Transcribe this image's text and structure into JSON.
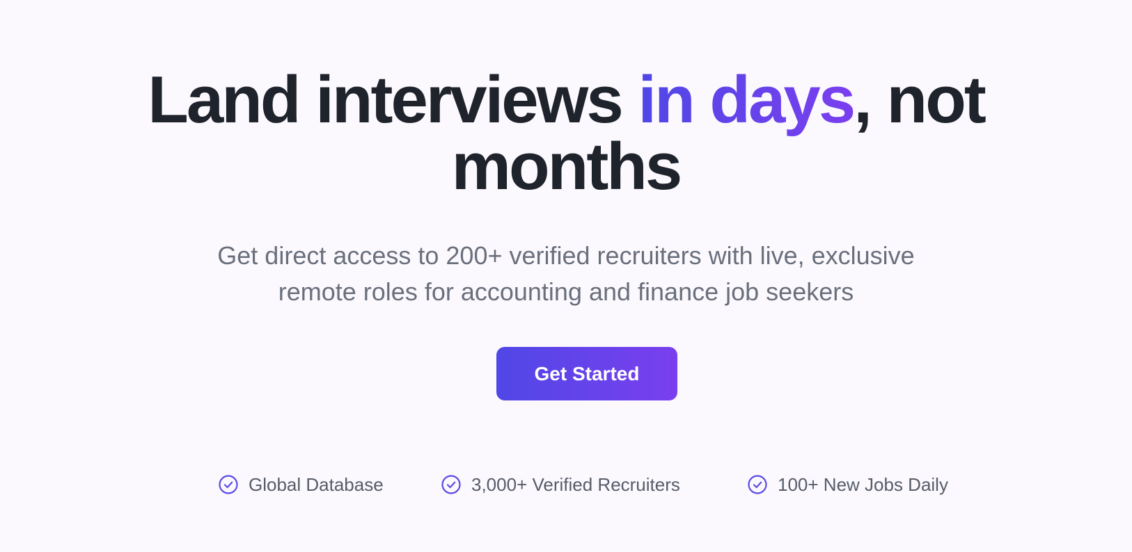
{
  "hero": {
    "headline": {
      "part1": "Land interviews ",
      "accent": "in days",
      "part2": ", not",
      "line2": "months"
    },
    "subtitle": {
      "line1": "Get direct access to 200+ verified recruiters with live, exclusive",
      "line2": "remote roles for accounting and finance job seekers"
    },
    "cta_label": "Get Started",
    "features": [
      {
        "icon": "check-circle-icon",
        "label": "Global Database"
      },
      {
        "icon": "check-circle-icon",
        "label": "3,000+ Verified Recruiters"
      },
      {
        "icon": "check-circle-icon",
        "label": "100+ New Jobs Daily"
      }
    ]
  },
  "colors": {
    "heading": "#1f232b",
    "accent_start": "#5047e6",
    "accent_end": "#7a3fee",
    "subtitle": "#6a6f7c",
    "background": "#fbf9fe"
  }
}
